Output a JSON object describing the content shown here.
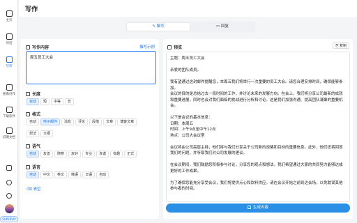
{
  "sidebar": {
    "items": [
      {
        "label": "主页"
      },
      {
        "label": "对话"
      },
      {
        "label": "写作"
      },
      {
        "label": "图像创作"
      },
      {
        "label": "下载软件"
      },
      {
        "label": "说明文档"
      }
    ],
    "vip_badge": "SUPERVIP"
  },
  "header": {
    "title": "写作"
  },
  "tabs": [
    {
      "label": "撰写"
    },
    {
      "label": "回复"
    }
  ],
  "form": {
    "content_label": "写作内容",
    "example_link": "撰写示例",
    "content_value": "周五员工大会",
    "length": {
      "label": "长度",
      "options": [
        "自动",
        "短",
        "中等",
        "长"
      ],
      "selected": "自动"
    },
    "format": {
      "label": "格式",
      "row1": [
        "自动",
        "电子邮件",
        "消息",
        "评论",
        "段落",
        "文章",
        "博客文章"
      ],
      "row2": [
        "想法",
        "大纲"
      ],
      "selected": "电子邮件"
    },
    "tone": {
      "label": "语气",
      "options": [
        "自动",
        "友善",
        "随意",
        "友好",
        "专业",
        "诙谐",
        "有趣",
        "正式"
      ],
      "selected": "自动"
    },
    "language": {
      "label": "语言",
      "options": [
        "自动",
        "中文",
        "英文",
        "韩语",
        "日语",
        "自动"
      ],
      "selected": "自动"
    },
    "clear_label": "清空"
  },
  "preview": {
    "label": "预览",
    "copy_label": "复制",
    "lines": [
      "主题：周五员工大会",
      "",
      "亲爱的团队成员，",
      "",
      "我有望通过这封邮件提醒您，本周五我们将举行一次重要的员工大会。请您合理安排时间，确保能够参加。",
      "会议的目的是总结过去一段时间的工作，并讨论未来的发展方向。在会上，我们将分享公司最新的成就和重要进展，同时也会对我们面临的挑战进行分析和讨论。这是我们加强沟通、提高团队凝聚的重要机会。",
      "",
      "以下是会议的基本信息：",
      "日期：本周五",
      "时间：上午9点至中午12点",
      "地点：公司大会议室",
      "",
      "会议将由公司高层主持，他们将与我们分享关于公司新的战略和目标的重要信息。此外，他们还将回答我们的问题，并听取我们对公司发展的建议。",
      "",
      "在会议期间，我们鼓励您积极参与讨论，分享您的观点和想法。我们希望通过大家的共同努力能够达成更好的工作成果。",
      "",
      "为了确保您能充分享受会议，我们将提供点心和饮料供应。请在会议开始之前到达会场，以免耽误其他参与者的时间。"
    ],
    "generate_label": "生成内容"
  }
}
